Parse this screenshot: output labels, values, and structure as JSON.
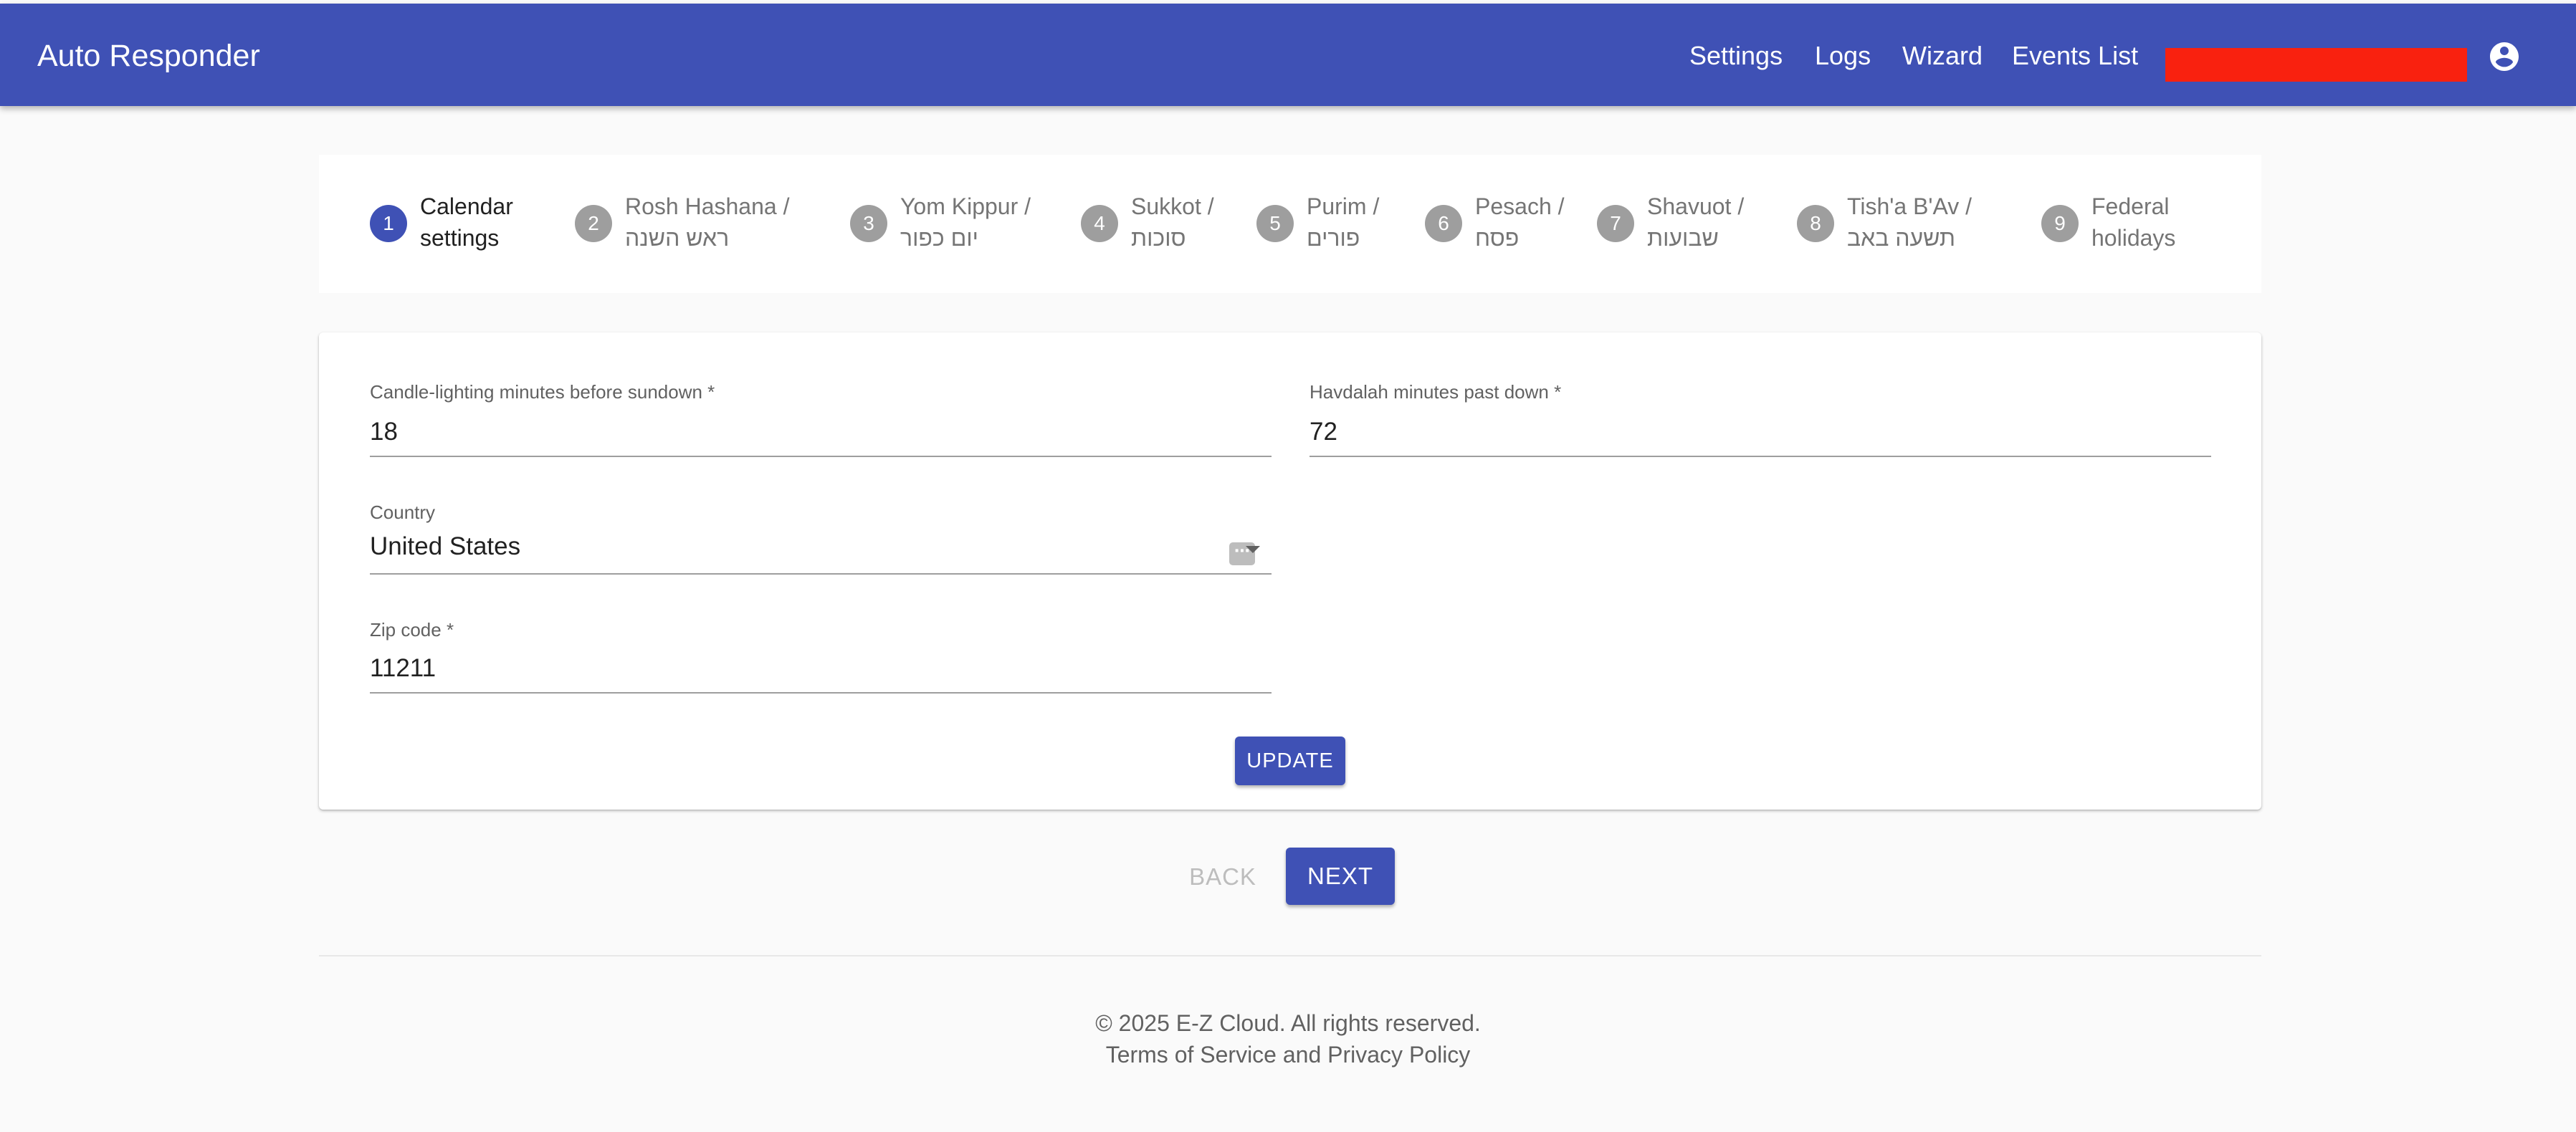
{
  "app": {
    "title": "Auto Responder"
  },
  "nav": {
    "items": [
      {
        "label": "Settings"
      },
      {
        "label": "Logs"
      },
      {
        "label": "Wizard"
      },
      {
        "label": "Events List"
      }
    ]
  },
  "colors": {
    "primary": "#3f51b5",
    "redaction": "#f9210f",
    "inactive_step": "#9e9e9e"
  },
  "icons": {
    "account": "account-circle-icon",
    "select": "dropdown-arrow-icon",
    "options": "more-options-icon"
  },
  "stepper": {
    "active_step": 1,
    "steps": [
      {
        "number": "1",
        "line1": "Calendar",
        "line2": "settings"
      },
      {
        "number": "2",
        "line1": "Rosh Hashana /",
        "line2": "ראש השנה"
      },
      {
        "number": "3",
        "line1": "Yom Kippur /",
        "line2": "יום כפור"
      },
      {
        "number": "4",
        "line1": "Sukkot /",
        "line2": "סוכות"
      },
      {
        "number": "5",
        "line1": "Purim /",
        "line2": "פורים"
      },
      {
        "number": "6",
        "line1": "Pesach /",
        "line2": "פסח"
      },
      {
        "number": "7",
        "line1": "Shavuot /",
        "line2": "שבועות"
      },
      {
        "number": "8",
        "line1": "Tish'a B'Av /",
        "line2": "תשעה באב"
      },
      {
        "number": "9",
        "line1": "Federal",
        "line2": "holidays"
      }
    ]
  },
  "form": {
    "candle_lighting": {
      "label": "Candle-lighting minutes before sundown *",
      "value": "18"
    },
    "havdalah": {
      "label": "Havdalah minutes past down *",
      "value": "72"
    },
    "country": {
      "label": "Country",
      "value": "United States"
    },
    "zip": {
      "label": "Zip code *",
      "value": "11211"
    },
    "update_label": "UPDATE"
  },
  "wizard_nav": {
    "back_label": "BACK",
    "next_label": "NEXT"
  },
  "footer": {
    "copyright": "© 2025 E-Z Cloud. All rights reserved.",
    "terms": "Terms of Service",
    "and": "and",
    "privacy": "Privacy Policy"
  }
}
